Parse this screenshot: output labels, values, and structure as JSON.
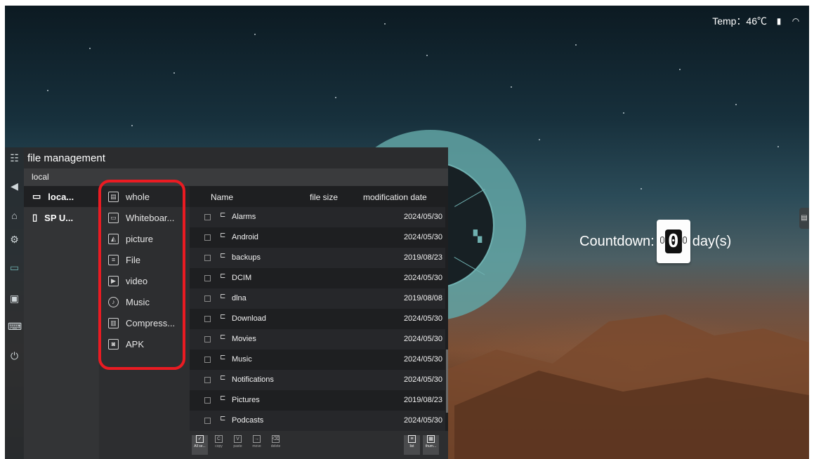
{
  "status_bar": {
    "temperature": "Temp：46℃",
    "icons": [
      "usb-icon",
      "wifi-icon"
    ]
  },
  "dock": {
    "icons": [
      "grid-menu-icon",
      "back-icon",
      "home-icon",
      "settings-icon",
      "folder-icon",
      "screen-icon",
      "keyboard-icon",
      "power-icon"
    ]
  },
  "countdown": {
    "label": "Countdown:",
    "value": "0",
    "unit": "day(s)"
  },
  "file_manager": {
    "title": "file management",
    "breadcrumb": "local",
    "devices": [
      {
        "label": "loca...",
        "icon": "monitor-icon"
      },
      {
        "label": "SP U...",
        "icon": "usb-drive-icon"
      }
    ],
    "categories": [
      {
        "label": "whole",
        "icon": "whole-icon"
      },
      {
        "label": "Whiteboar...",
        "icon": "whiteboard-icon"
      },
      {
        "label": "picture",
        "icon": "picture-icon"
      },
      {
        "label": "File",
        "icon": "file-icon"
      },
      {
        "label": "video",
        "icon": "video-icon"
      },
      {
        "label": "Music",
        "icon": "music-icon"
      },
      {
        "label": "Compress...",
        "icon": "compress-icon"
      },
      {
        "label": "APK",
        "icon": "apk-icon"
      }
    ],
    "columns": {
      "name": "Name",
      "size": "file size",
      "date": "modification date"
    },
    "files": [
      {
        "name": "Alarms",
        "date": "2024/05/30"
      },
      {
        "name": "Android",
        "date": "2024/05/30"
      },
      {
        "name": "backups",
        "date": "2019/08/23"
      },
      {
        "name": "DCIM",
        "date": "2024/05/30"
      },
      {
        "name": "dlna",
        "date": "2019/08/08"
      },
      {
        "name": "Download",
        "date": "2024/05/30"
      },
      {
        "name": "Movies",
        "date": "2024/05/30"
      },
      {
        "name": "Music",
        "date": "2024/05/30"
      },
      {
        "name": "Notifications",
        "date": "2024/05/30"
      },
      {
        "name": "Pictures",
        "date": "2019/08/23"
      },
      {
        "name": "Podcasts",
        "date": "2024/05/30"
      }
    ],
    "toolbar": {
      "select_all": "All se...",
      "copy": "copy",
      "paste": "paste",
      "move": "move",
      "delete": "delete",
      "list": "list",
      "thumbnail": "thum..."
    }
  },
  "colors": {
    "highlight": "#ea1b22",
    "accent": "#62a4a4"
  }
}
